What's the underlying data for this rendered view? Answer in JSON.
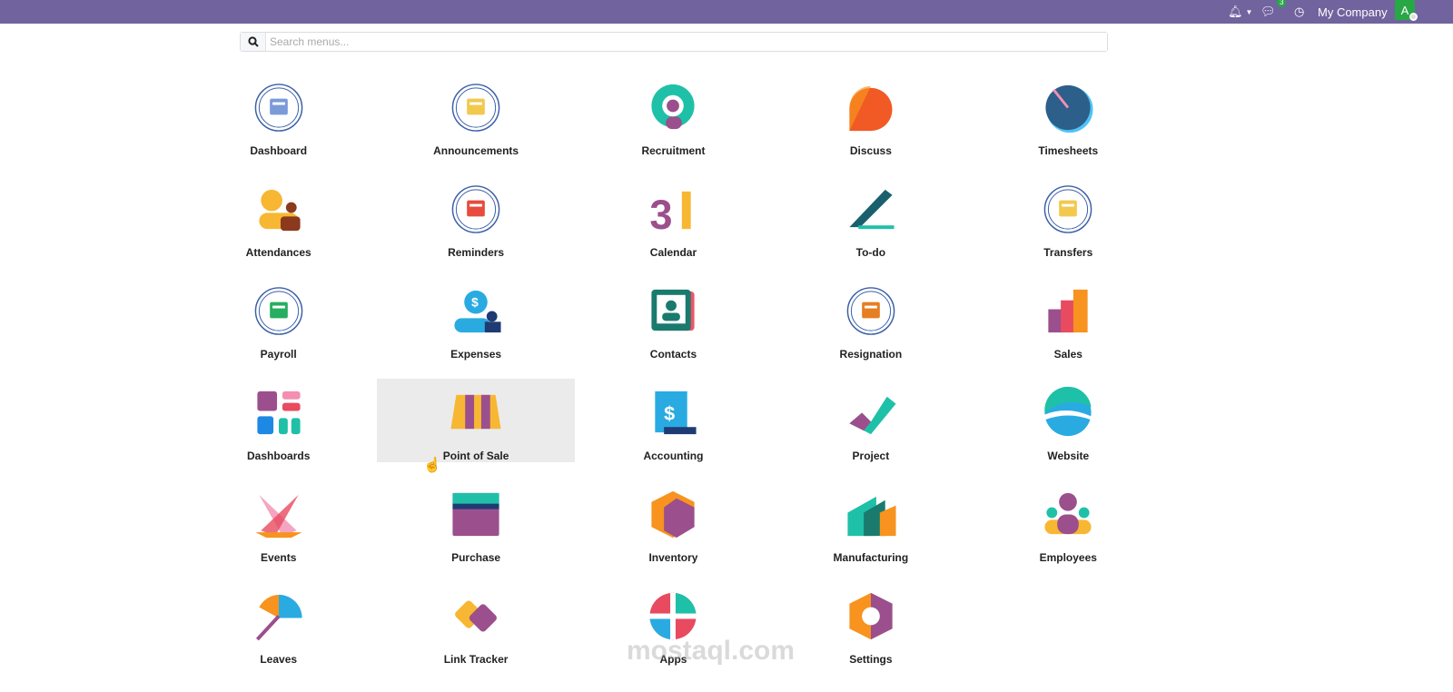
{
  "topbar": {
    "notifications_icon": "bell-icon",
    "messages_count": "3",
    "company": "My Company",
    "avatar_letter": "A"
  },
  "search": {
    "placeholder": "Search menus..."
  },
  "apps": [
    {
      "label": "Dashboard",
      "icon": "ring",
      "c": [
        "#3b5fa8",
        "#7a9bd8"
      ]
    },
    {
      "label": "Announcements",
      "icon": "ring",
      "c": [
        "#3b5fa8",
        "#f2c94c"
      ]
    },
    {
      "label": "Recruitment",
      "icon": "recruit",
      "c": [
        "#1fc0a8",
        "#9b4f8c"
      ]
    },
    {
      "label": "Discuss",
      "icon": "discuss",
      "c": [
        "#f7931e",
        "#f15a24"
      ]
    },
    {
      "label": "Timesheets",
      "icon": "timesheet",
      "c": [
        "#2c5f8a",
        "#4fc3f7"
      ]
    },
    {
      "label": "Attendances",
      "icon": "attend",
      "c": [
        "#f7b733",
        "#8b3a1e"
      ]
    },
    {
      "label": "Reminders",
      "icon": "ring",
      "c": [
        "#3b5fa8",
        "#e74c3c"
      ]
    },
    {
      "label": "Calendar",
      "icon": "calendar",
      "c": [
        "#9b4f8c",
        "#f7b733"
      ]
    },
    {
      "label": "To-do",
      "icon": "todo",
      "c": [
        "#1a5f6e",
        "#1fc0a8"
      ]
    },
    {
      "label": "Transfers",
      "icon": "ring",
      "c": [
        "#3b5fa8",
        "#f2c94c"
      ]
    },
    {
      "label": "Payroll",
      "icon": "ring",
      "c": [
        "#3b5fa8",
        "#27ae60"
      ]
    },
    {
      "label": "Expenses",
      "icon": "expense",
      "c": [
        "#29abe2",
        "#1f3b73"
      ]
    },
    {
      "label": "Contacts",
      "icon": "contacts",
      "c": [
        "#1a7a6e",
        "#e8576b"
      ]
    },
    {
      "label": "Resignation",
      "icon": "ring",
      "c": [
        "#3b5fa8",
        "#e67e22"
      ]
    },
    {
      "label": "Sales",
      "icon": "sales",
      "c": [
        "#9b4f8c",
        "#f7931e"
      ]
    },
    {
      "label": "Dashboards",
      "icon": "dashboards",
      "c": [
        "#9b4f8c",
        "#e84a5f"
      ]
    },
    {
      "label": "Point of Sale",
      "icon": "pos",
      "c": [
        "#f7b733",
        "#9b4f8c"
      ]
    },
    {
      "label": "Accounting",
      "icon": "accounting",
      "c": [
        "#29abe2",
        "#1f3b73"
      ]
    },
    {
      "label": "Project",
      "icon": "project",
      "c": [
        "#1fc0a8",
        "#9b4f8c"
      ]
    },
    {
      "label": "Website",
      "icon": "website",
      "c": [
        "#1fc0a8",
        "#29abe2"
      ]
    },
    {
      "label": "Events",
      "icon": "events",
      "c": [
        "#f7931e",
        "#e84a5f"
      ]
    },
    {
      "label": "Purchase",
      "icon": "purchase",
      "c": [
        "#1fc0a8",
        "#9b4f8c"
      ]
    },
    {
      "label": "Inventory",
      "icon": "inventory",
      "c": [
        "#f7931e",
        "#9b4f8c"
      ]
    },
    {
      "label": "Manufacturing",
      "icon": "mfg",
      "c": [
        "#1fc0a8",
        "#f7931e"
      ]
    },
    {
      "label": "Employees",
      "icon": "employees",
      "c": [
        "#9b4f8c",
        "#1fc0a8"
      ]
    },
    {
      "label": "Leaves",
      "icon": "leaves",
      "c": [
        "#f7931e",
        "#29abe2"
      ]
    },
    {
      "label": "Link Tracker",
      "icon": "link",
      "c": [
        "#f7b733",
        "#9b4f8c"
      ]
    },
    {
      "label": "Apps",
      "icon": "apps",
      "c": [
        "#e84a5f",
        "#29abe2"
      ]
    },
    {
      "label": "Settings",
      "icon": "settings",
      "c": [
        "#f7931e",
        "#9b4f8c"
      ]
    }
  ],
  "hovered_app": "Point of Sale",
  "watermark": "mostaql.com"
}
